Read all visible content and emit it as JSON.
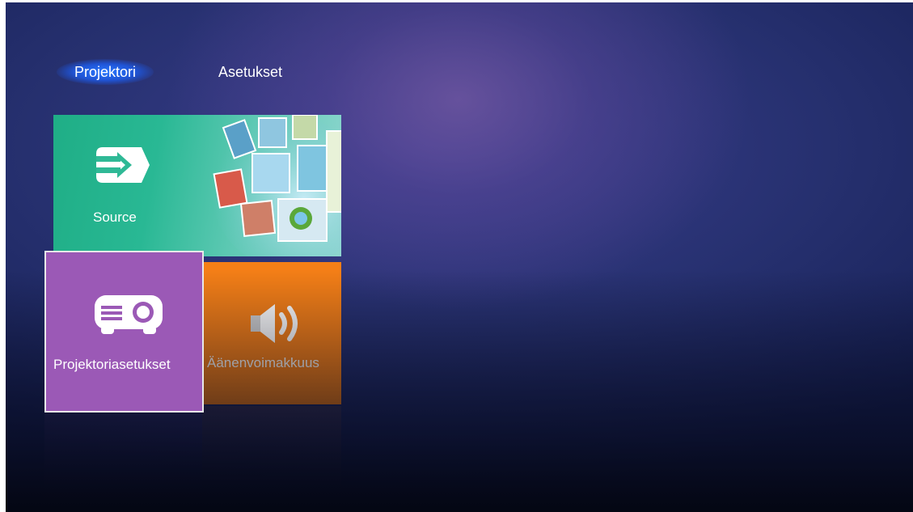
{
  "tabs": [
    {
      "label": "Projektori",
      "active": true
    },
    {
      "label": "Asetukset",
      "active": false
    }
  ],
  "tiles": {
    "source": {
      "label": "Source",
      "color": "#29b894",
      "icon": "source-input-icon"
    },
    "projector_settings": {
      "label": "Projektoriasetukset",
      "color": "#9b59b6",
      "icon": "projector-icon",
      "selected": true
    },
    "volume": {
      "label": "Äänenvoimakkuus",
      "color": "#f57f17",
      "icon": "speaker-icon"
    }
  },
  "colors": {
    "background": "#26306f",
    "active_tab_glow": "#2878ff"
  }
}
